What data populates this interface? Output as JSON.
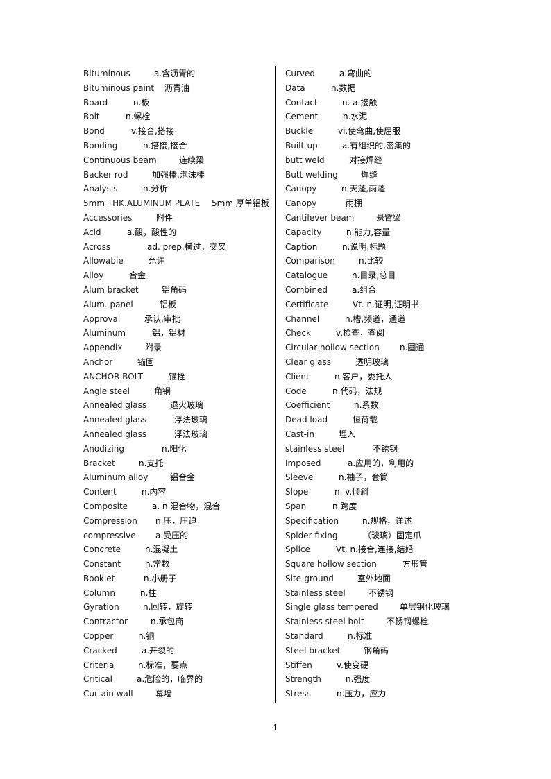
{
  "page_number": "4",
  "left_column": [
    {
      "term": "Bituminous",
      "definition": "a.含沥青的"
    },
    {
      "term": "Bituminous paint",
      "definition": "沥青油"
    },
    {
      "term": "Board",
      "definition": "n.板"
    },
    {
      "term": "Bolt",
      "definition": "n.螺栓"
    },
    {
      "term": "Bond",
      "definition": "v.接合,搭接"
    },
    {
      "term": "Bonding",
      "definition": "n.搭接,接合"
    },
    {
      "term": "Continuous beam",
      "definition": "连续梁"
    },
    {
      "term": "Backer rod",
      "definition": "加强棒,泡沫棒"
    },
    {
      "term": "Analysis",
      "definition": "n.分析"
    },
    {
      "term": "5mm THK.ALUMINUM PLATE",
      "definition": "5mm 厚单铝板"
    },
    {
      "term": "Accessories",
      "definition": "附件"
    },
    {
      "term": "Acid",
      "definition": "a.酸，酸性的"
    },
    {
      "term": "Across",
      "definition": "ad. prep.横过，交叉"
    },
    {
      "term": "Allowable",
      "definition": "允许"
    },
    {
      "term": "Alloy",
      "definition": "合金"
    },
    {
      "term": "Alum bracket",
      "definition": "铝角码"
    },
    {
      "term": "Alum. panel",
      "definition": "铝板"
    },
    {
      "term": "Approval",
      "definition": "承认,审批"
    },
    {
      "term": "Aluminum",
      "definition": "铝，铝材"
    },
    {
      "term": "Appendix",
      "definition": "附录"
    },
    {
      "term": "Anchor",
      "definition": "锚固"
    },
    {
      "term": "ANCHOR BOLT",
      "definition": "锚拴"
    },
    {
      "term": "Angle steel",
      "definition": "角钢"
    },
    {
      "term": "Annealed glass",
      "definition": "退火玻璃"
    },
    {
      "term": "Annealed glass",
      "definition": "浮法玻璃"
    },
    {
      "term": "Annealed glass",
      "definition": "浮法玻璃"
    },
    {
      "term": "Anodizing",
      "definition": "n.阳化"
    },
    {
      "term": "Bracket",
      "definition": "n.支托"
    },
    {
      "term": "Aluminum alloy",
      "definition": "铝合金"
    },
    {
      "term": "Content",
      "definition": "n.内容"
    },
    {
      "term": "Composite",
      "definition": "a. n.混合物，混合"
    },
    {
      "term": "Compression",
      "definition": "n.压，压迫"
    },
    {
      "term": "compressive",
      "definition": "a.受压的"
    },
    {
      "term": "Concrete",
      "definition": "n.混凝土"
    },
    {
      "term": "Constant",
      "definition": "n.常数"
    },
    {
      "term": "Booklet",
      "definition": "n.小册子"
    },
    {
      "term": "Column",
      "definition": "n.柱"
    },
    {
      "term": "Gyration",
      "definition": "n.回转，旋转"
    },
    {
      "term": "Contractor",
      "definition": "n.承包商"
    },
    {
      "term": "Copper",
      "definition": "n.铜"
    },
    {
      "term": "Cracked",
      "definition": "a.开裂的"
    },
    {
      "term": "Criteria",
      "definition": "n.标准，要点"
    },
    {
      "term": "Critical",
      "definition": "a.危险的，临界的"
    },
    {
      "term": "Curtain wall",
      "definition": "幕墙"
    }
  ],
  "right_column": [
    {
      "term": "Curved",
      "definition": "a.弯曲的"
    },
    {
      "term": "Data",
      "definition": "n.数据"
    },
    {
      "term": "Contact",
      "definition": "n. a.接触"
    },
    {
      "term": "Cement",
      "definition": "n.水泥"
    },
    {
      "term": "Buckle",
      "definition": "vi.使弯曲,使屈服"
    },
    {
      "term": "Built-up",
      "definition": "a.有组织的,密集的"
    },
    {
      "term": "butt weld",
      "definition": "对接焊缝"
    },
    {
      "term": "Butt welding",
      "definition": "焊缝"
    },
    {
      "term": "Canopy",
      "definition": "n.天蓬,雨蓬"
    },
    {
      "term": "Canopy",
      "definition": "雨棚"
    },
    {
      "term": "Cantilever beam",
      "definition": "悬臂梁"
    },
    {
      "term": "Capacity",
      "definition": "n.能力,容量"
    },
    {
      "term": "Caption",
      "definition": "n.说明,标题"
    },
    {
      "term": "Comparison",
      "definition": "n.比较"
    },
    {
      "term": "Catalogue",
      "definition": "n.目录,总目"
    },
    {
      "term": "Combined",
      "definition": "a.组合"
    },
    {
      "term": "Certificate",
      "definition": "Vt. n.证明,证明书"
    },
    {
      "term": "Channel",
      "definition": "n.槽,频道，通道"
    },
    {
      "term": "Check",
      "definition": "v.检查，查阅"
    },
    {
      "term": "Circular hollow section",
      "definition": "n.圆通"
    },
    {
      "term": "Clear glass",
      "definition": "透明玻璃"
    },
    {
      "term": "Client",
      "definition": "n.客户，委托人"
    },
    {
      "term": "Code",
      "definition": "n.代码，法规"
    },
    {
      "term": "Coefficient",
      "definition": "n.系数"
    },
    {
      "term": "Dead load",
      "definition": "恒荷载"
    },
    {
      "term": "Cast-in",
      "definition": "埋入"
    },
    {
      "term": "stainless steel",
      "definition": "不锈钢"
    },
    {
      "term": "Imposed",
      "definition": "a.应用的，利用的"
    },
    {
      "term": "Sleeve",
      "definition": "n.袖子，套筒"
    },
    {
      "term": "Slope",
      "definition": "n. v.倾斜"
    },
    {
      "term": "Span",
      "definition": "n.跨度"
    },
    {
      "term": "Specification",
      "definition": "n.规格，详述"
    },
    {
      "term": "Spider fixing",
      "definition": "（玻璃）固定爪"
    },
    {
      "term": "Splice",
      "definition": "Vt. n.接合,连接,结婚"
    },
    {
      "term": "Square hollow section",
      "definition": "方形管"
    },
    {
      "term": "Site-ground",
      "definition": "室外地面"
    },
    {
      "term": "Stainless steel",
      "definition": "不锈钢"
    },
    {
      "term": "Single glass tempered",
      "definition": "单层钢化玻璃"
    },
    {
      "term": "Stainless steel bolt",
      "definition": "不锈钢螺栓"
    },
    {
      "term": "Standard",
      "definition": "n.标准"
    },
    {
      "term": "Steel bracket",
      "definition": "钢角码"
    },
    {
      "term": "Stiffen",
      "definition": "v.使变硬"
    },
    {
      "term": "Strength",
      "definition": "n.强度"
    },
    {
      "term": "Stress",
      "definition": "n.压力，应力"
    }
  ]
}
